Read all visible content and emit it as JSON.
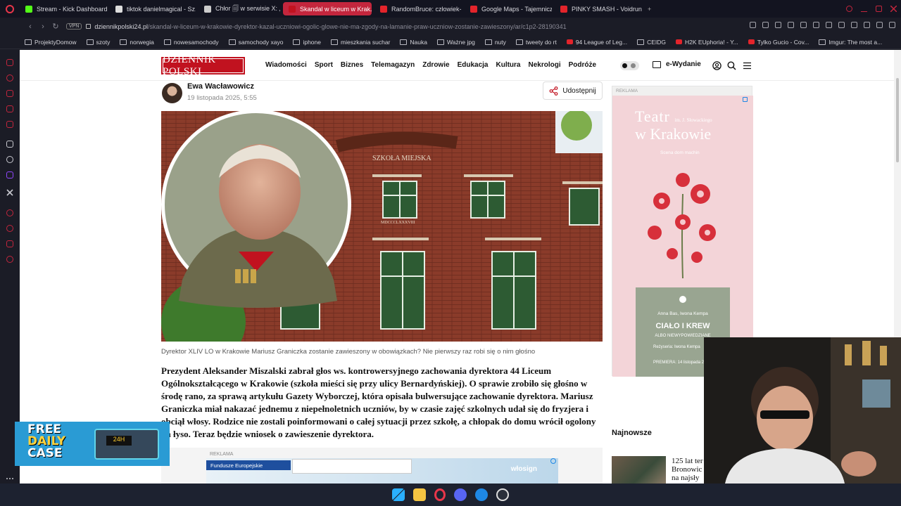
{
  "browser": {
    "tabs": [
      {
        "label": "Stream - Kick Dashboard",
        "color": "#53fc18",
        "active": false,
        "width": 124
      },
      {
        "label": "tiktok danielmagical - Sz...",
        "color": "#dddddd",
        "active": false,
        "width": 122
      },
      {
        "label": "Chłor 🗐 w serwisie X: „j",
        "color": "#cccccc",
        "active": false,
        "width": 116
      },
      {
        "label": "Skandal w liceum w Krak...",
        "color": "#c1121f",
        "active": true,
        "width": 126
      },
      {
        "label": "RandomBruce: człowiek-...",
        "color": "#e3242b",
        "active": false,
        "width": 124
      },
      {
        "label": "Google Maps - Tajemnicz...",
        "color": "#e3242b",
        "active": false,
        "width": 124
      },
      {
        "label": "PINKY SMASH - Voidrunn...",
        "color": "#e3242b",
        "active": false,
        "width": 124
      }
    ],
    "new_tab": "+",
    "vpn": "VPN",
    "url_host": "dziennikpolski24.pl",
    "url_path": "/skandal-w-liceum-w-krakowie-dyrektor-kazal-uczniowi-ogolic-glowe-nie-ma-zgody-na-lamanie-praw-uczniow-zostanie-zawieszony/ar/c1p2-28190341",
    "bookmarks": [
      {
        "label": "ProjektyDomow",
        "type": "folder"
      },
      {
        "label": "szoty",
        "type": "folder"
      },
      {
        "label": "norwegia",
        "type": "folder"
      },
      {
        "label": "nowesamochody",
        "type": "folder"
      },
      {
        "label": "samochody xayo",
        "type": "folder"
      },
      {
        "label": "iphone",
        "type": "folder"
      },
      {
        "label": "mieszkania suchar",
        "type": "folder"
      },
      {
        "label": "Nauka",
        "type": "folder"
      },
      {
        "label": "Ważne jpg",
        "type": "folder"
      },
      {
        "label": "nuty",
        "type": "folder"
      },
      {
        "label": "tweety do rt",
        "type": "folder"
      },
      {
        "label": "94 League of Leg...",
        "type": "yt"
      },
      {
        "label": "CEIDG",
        "type": "site"
      },
      {
        "label": "H2K EUphoria! - Y...",
        "type": "yt"
      },
      {
        "label": "Tylko Gucio - Cov...",
        "type": "yt"
      },
      {
        "label": "Imgur: The most a...",
        "type": "site"
      }
    ]
  },
  "site": {
    "logo": "DZIENNIK POLSKI",
    "nav": [
      "Wiadomości",
      "Sport",
      "Biznes",
      "Telemagazyn",
      "Zdrowie",
      "Edukacja",
      "Kultura",
      "Nekrologi",
      "Podróże"
    ],
    "ewydanie": "e-Wydanie"
  },
  "article": {
    "author": "Ewa Wacławowicz",
    "date": "19 listopada 2025, 5:55",
    "share": "Udostępnij",
    "caption": "Dyrektor XLIV LO w Krakowie Mariusz Graniczka zostanie zawieszony w obowiązkach? Nie pierwszy raz robi się o nim głośno",
    "lead": "Prezydent Aleksander Miszalski zabrał głos ws. kontrowersyjnego zachowania dyrektora 44 Liceum Ogólnokształcącego w Krakowie (szkoła mieści się przy ulicy Bernardyńskiej). O sprawie zrobiło się głośno w środę rano, za sprawą artykułu Gazety Wyborczej, która opisała bulwersujące zachowanie dyrektora. Mariusz Graniczka miał nakazać jednemu z niepełnoletnich uczniów, by w czasie zajęć szkolnych udał się do fryzjera i obciął włosy. Rodzice nie zostali poinformowani o całej sytuacji przez szkołę, a chłopak do domu wrócił ogolony na łyso. Teraz będzie wniosek o zawieszenie dyrektora.",
    "hero_facade_text": "SZKOŁA MIEJSKA",
    "hero_roman": "MDCCCLXXXVIII"
  },
  "ads": {
    "reklama": "REKLAMA",
    "side": {
      "title1": "Teatr",
      "small": "im. J. Słowackiego",
      "title2": "w Krakowie",
      "sub": "Scena dom machin",
      "authors": "Anna Bas, Iwona Kempa",
      "play": "CIAŁO I KREW",
      "play_sub": "ALBO NIEWYPOWIEDZIANE",
      "director": "Reżyseria: Iwona Kempa",
      "premiere": "PREMIERA: 14 listopada 2025"
    },
    "bottom": {
      "label": "Fundusze Europejskie",
      "brand": "włosign"
    },
    "float": {
      "line1": "FREE",
      "line2": "DAILY",
      "line3": "CASE",
      "screen": "24H"
    }
  },
  "sidebar_right": {
    "najnowsze": "Najnowsze",
    "news_text": [
      "125 lat ter",
      "Bronowic",
      "na najsły"
    ]
  }
}
